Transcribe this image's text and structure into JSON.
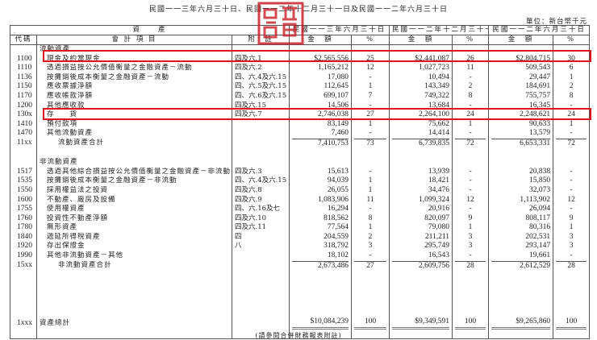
{
  "header": {
    "title": "民國一一三年六月三十日、民國一一二年十二月三十一日及民國一一二年六月三十日",
    "unit": "單位：新台幣千元"
  },
  "columns": {
    "assets": "資　　產",
    "code": "代碼",
    "item": "會 計 項 目",
    "note": "附　註",
    "period1": "民國一一三年六月三十日",
    "period2": "民國一一二年十二月三十一日",
    "period3": "民國一一二年六月三十日",
    "amount": "金　額",
    "pct": "%"
  },
  "seal_text": "會計師印",
  "highlight_color": "#e0141e",
  "rows": [
    {
      "type": "section",
      "code": "",
      "name": "流動資產",
      "note": "",
      "a1": "",
      "p1": "",
      "a2": "",
      "p2": "",
      "a3": "",
      "p3": ""
    },
    {
      "type": "item",
      "hl": true,
      "code": "1100",
      "name": "現金及約當現金",
      "note": "四及六.1",
      "a1": "$2,565,556",
      "p1": "25",
      "a2": "$2,441,087",
      "p2": "26",
      "a3": "$2,804,715",
      "p3": "30"
    },
    {
      "type": "item",
      "code": "1110",
      "name": "透過損益按公允價值衡量之金融資產－流動",
      "note": "四及六.2",
      "a1": "1,165,212",
      "p1": "12",
      "a2": "1,027,723",
      "p2": "11",
      "a3": "509,543",
      "p3": "6"
    },
    {
      "type": "item",
      "code": "1136",
      "name": "按攤銷後成本衡量之金融資產－流動",
      "note": "四、六.4及六.15",
      "a1": "17,080",
      "p1": "-",
      "a2": "10,494",
      "p2": "-",
      "a3": "29,447",
      "p3": "1"
    },
    {
      "type": "item",
      "code": "1150",
      "name": "應收票據淨額",
      "note": "四、六.5及六.15",
      "a1": "112,645",
      "p1": "1",
      "a2": "143,349",
      "p2": "2",
      "a3": "184,691",
      "p3": "2"
    },
    {
      "type": "item",
      "code": "1170",
      "name": "應收帳款淨額",
      "note": "四、六.6及六.15",
      "a1": "699,107",
      "p1": "7",
      "a2": "749,322",
      "p2": "8",
      "a3": "755,757",
      "p3": "8"
    },
    {
      "type": "item",
      "code": "1200",
      "name": "其他應收款",
      "note": "四及六.15",
      "a1": "14,506",
      "p1": "-",
      "a2": "13,684",
      "p2": "-",
      "a3": "16,345",
      "p3": "-"
    },
    {
      "type": "item",
      "hl": true,
      "code": "130x",
      "name": "存　　貨",
      "note": "四及六.7",
      "a1": "2,746,038",
      "p1": "27",
      "a2": "2,264,100",
      "p2": "24",
      "a3": "2,248,621",
      "p3": "24"
    },
    {
      "type": "item",
      "code": "1410",
      "name": "預付款項",
      "note": "",
      "a1": "83,149",
      "p1": "1",
      "a2": "75,662",
      "p2": "1",
      "a3": "90,633",
      "p3": "1"
    },
    {
      "type": "item",
      "code": "1470",
      "name": "其他流動資產",
      "note": "",
      "a1": "7,460",
      "p1": "-",
      "a2": "14,414",
      "p2": "-",
      "a3": "13,579",
      "p3": "-"
    },
    {
      "type": "subtotal",
      "code": "11xx",
      "name": "流動資產合計",
      "note": "",
      "a1": "7,410,753",
      "p1": "73",
      "a2": "6,739,835",
      "p2": "72",
      "a3": "6,653,331",
      "p3": "72"
    },
    {
      "type": "blank"
    },
    {
      "type": "section",
      "code": "",
      "name": "非流動資產",
      "note": "",
      "a1": "",
      "p1": "",
      "a2": "",
      "p2": "",
      "a3": "",
      "p3": ""
    },
    {
      "type": "item",
      "code": "1517",
      "name": "透過其他綜合損益按公允價值衡量之金融資產－非流動",
      "note": "四及六.3",
      "a1": "15,613",
      "p1": "-",
      "a2": "13,939",
      "p2": "-",
      "a3": "20,838",
      "p3": "-"
    },
    {
      "type": "item",
      "code": "1535",
      "name": "按攤銷後成本衡量之金融資產－非流動",
      "note": "四、六.4及六.15",
      "a1": "94,039",
      "p1": "1",
      "a2": "18,421",
      "p2": "-",
      "a3": "15,850",
      "p3": "-"
    },
    {
      "type": "item",
      "code": "1550",
      "name": "採用權益法之投資",
      "note": "四及六.8",
      "a1": "26,055",
      "p1": "1",
      "a2": "34,476",
      "p2": "-",
      "a3": "32,073",
      "p3": "-"
    },
    {
      "type": "item",
      "code": "1600",
      "name": "不動產、廠房及設備",
      "note": "四及六.9",
      "a1": "1,083,906",
      "p1": "11",
      "a2": "1,099,324",
      "p2": "12",
      "a3": "1,113,902",
      "p3": "12"
    },
    {
      "type": "item",
      "code": "1755",
      "name": "使用權資產",
      "note": "四、六.16及七",
      "a1": "16,294",
      "p1": "-",
      "a2": "20,916",
      "p2": "-",
      "a3": "26,094",
      "p3": "-"
    },
    {
      "type": "item",
      "code": "1760",
      "name": "投資性不動產淨額",
      "note": "四及六.10",
      "a1": "818,562",
      "p1": "8",
      "a2": "820,097",
      "p2": "9",
      "a3": "808,117",
      "p3": "9"
    },
    {
      "type": "item",
      "code": "1780",
      "name": "無形資產",
      "note": "四及六.11",
      "a1": "77,564",
      "p1": "1",
      "a2": "79,080",
      "p2": "1",
      "a3": "80,316",
      "p3": "1"
    },
    {
      "type": "item",
      "code": "1840",
      "name": "遞延所得稅資產",
      "note": "四",
      "a1": "204,559",
      "p1": "2",
      "a2": "211,211",
      "p2": "3",
      "a3": "202,531",
      "p3": "3"
    },
    {
      "type": "item",
      "code": "1920",
      "name": "存出保證金",
      "note": "八",
      "a1": "318,792",
      "p1": "3",
      "a2": "295,749",
      "p2": "3",
      "a3": "293,147",
      "p3": "3"
    },
    {
      "type": "item",
      "code": "1990",
      "name": "其他非流動資產－其他",
      "note": "",
      "a1": "18,102",
      "p1": "-",
      "a2": "16,543",
      "p2": "-",
      "a3": "19,661",
      "p3": "-"
    },
    {
      "type": "subtotal",
      "code": "15xx",
      "name": "非流動資產合計",
      "note": "",
      "a1": "2,673,486",
      "p1": "27",
      "a2": "2,609,756",
      "p2": "28",
      "a3": "2,612,529",
      "p3": "28"
    },
    {
      "type": "spacer"
    },
    {
      "type": "total",
      "code": "1xxx",
      "name": "資產總計",
      "note": "",
      "a1": "$10,084,239",
      "p1": "100",
      "a2": "$9,349,591",
      "p2": "100",
      "a3": "$9,265,860",
      "p3": "100"
    },
    {
      "type": "blank"
    }
  ],
  "footer": "(請參閱合併財務報表附註)"
}
